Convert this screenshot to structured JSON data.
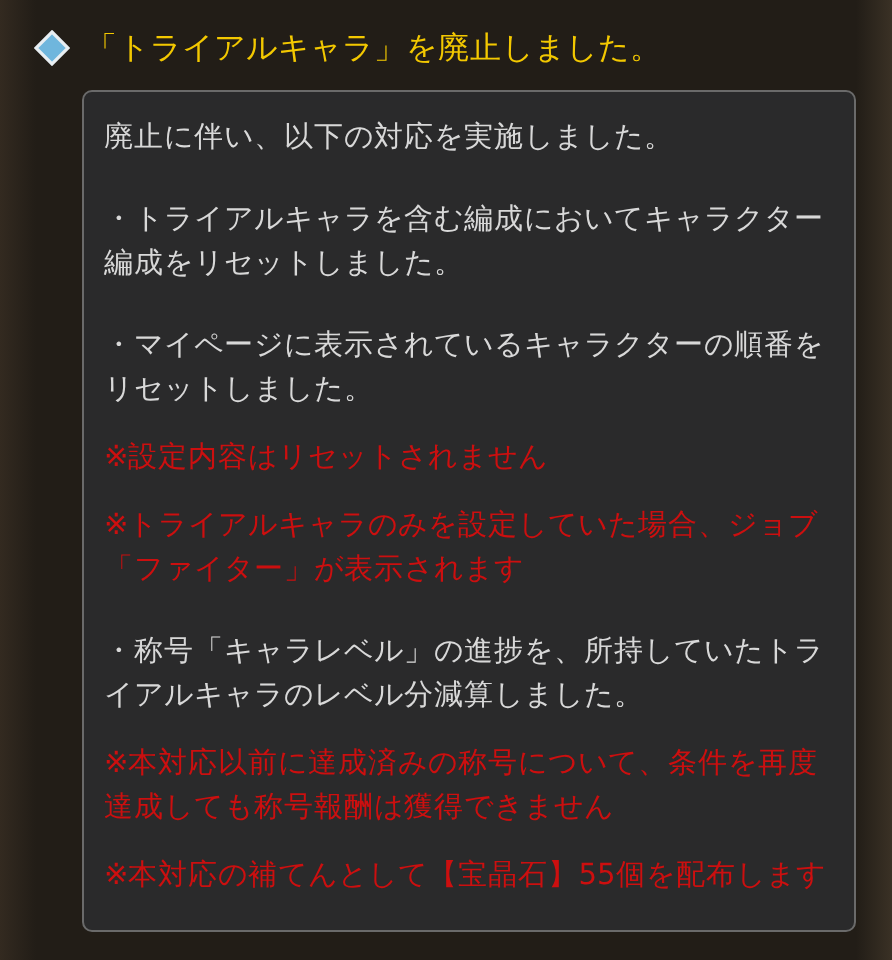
{
  "title": "「トライアルキャラ」を廃止しました。",
  "paragraphs": [
    {
      "kind": "body",
      "text": "廃止に伴い、以下の対応を実施しました。"
    },
    {
      "kind": "body",
      "text": "・トライアルキャラを含む編成においてキャラクター編成をリセットしました。"
    },
    {
      "kind": "body",
      "text": "・マイページに表示されているキャラクターの順番をリセットしました。"
    },
    {
      "kind": "note",
      "text": "※設定内容はリセットされません"
    },
    {
      "kind": "note",
      "text": "※トライアルキャラのみを設定していた場合、ジョブ「ファイター」が表示されます"
    },
    {
      "kind": "body",
      "text": "・称号「キャラレベル」の進捗を、所持していたトライアルキャラのレベル分減算しました。"
    },
    {
      "kind": "note",
      "text": "※本対応以前に達成済みの称号について、条件を再度達成しても称号報酬は獲得できません"
    },
    {
      "kind": "note",
      "text": "※本対応の補てんとして【宝晶石】55個を配布します"
    }
  ]
}
